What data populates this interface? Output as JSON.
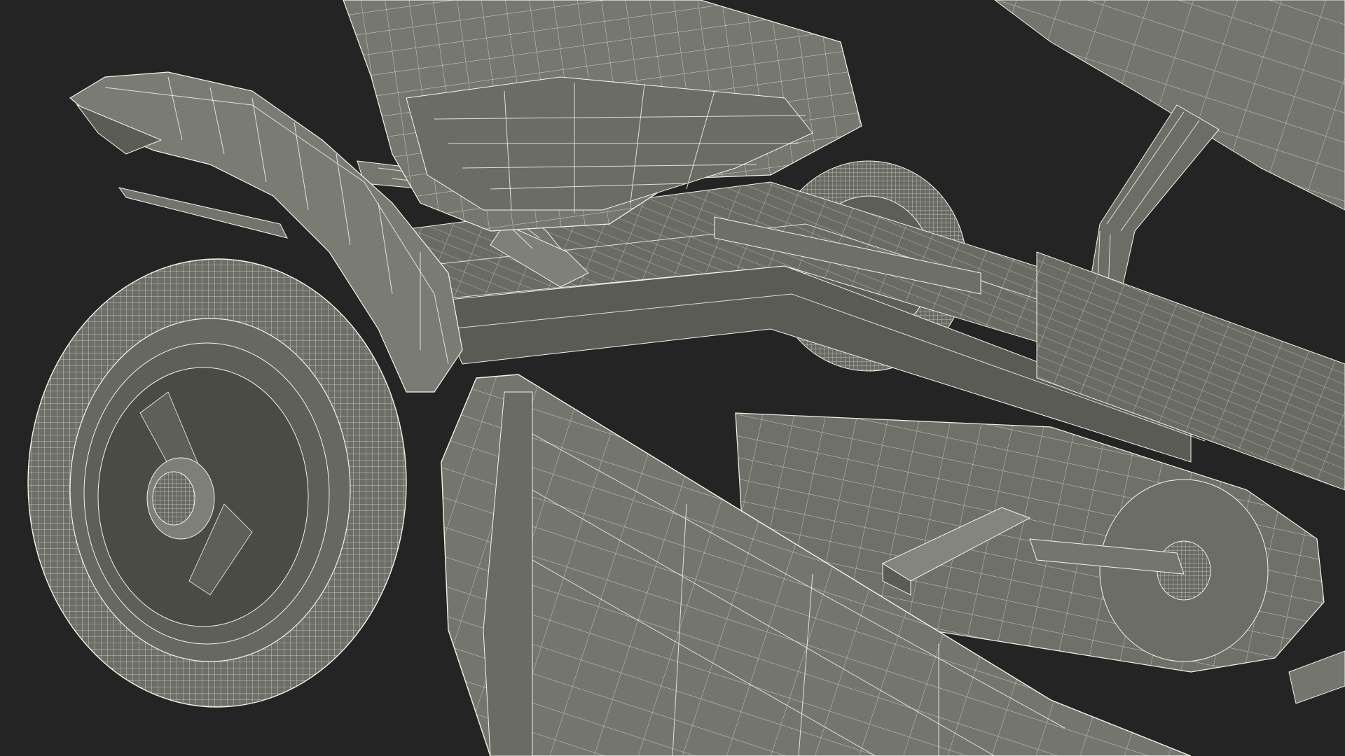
{
  "scene": {
    "background_color": "#242424",
    "mesh_color": "#75766d",
    "wire_color": "#f4f4ec",
    "subject": "wireframe-go-kart-render",
    "parts": [
      "seat-part",
      "front-fender-part",
      "front-wheel-part",
      "chassis-frame-part",
      "side-panel-part",
      "chain-guard-part",
      "pedal-part",
      "steering-column-part",
      "rear-wheel-part",
      "roll-bar-part"
    ]
  }
}
